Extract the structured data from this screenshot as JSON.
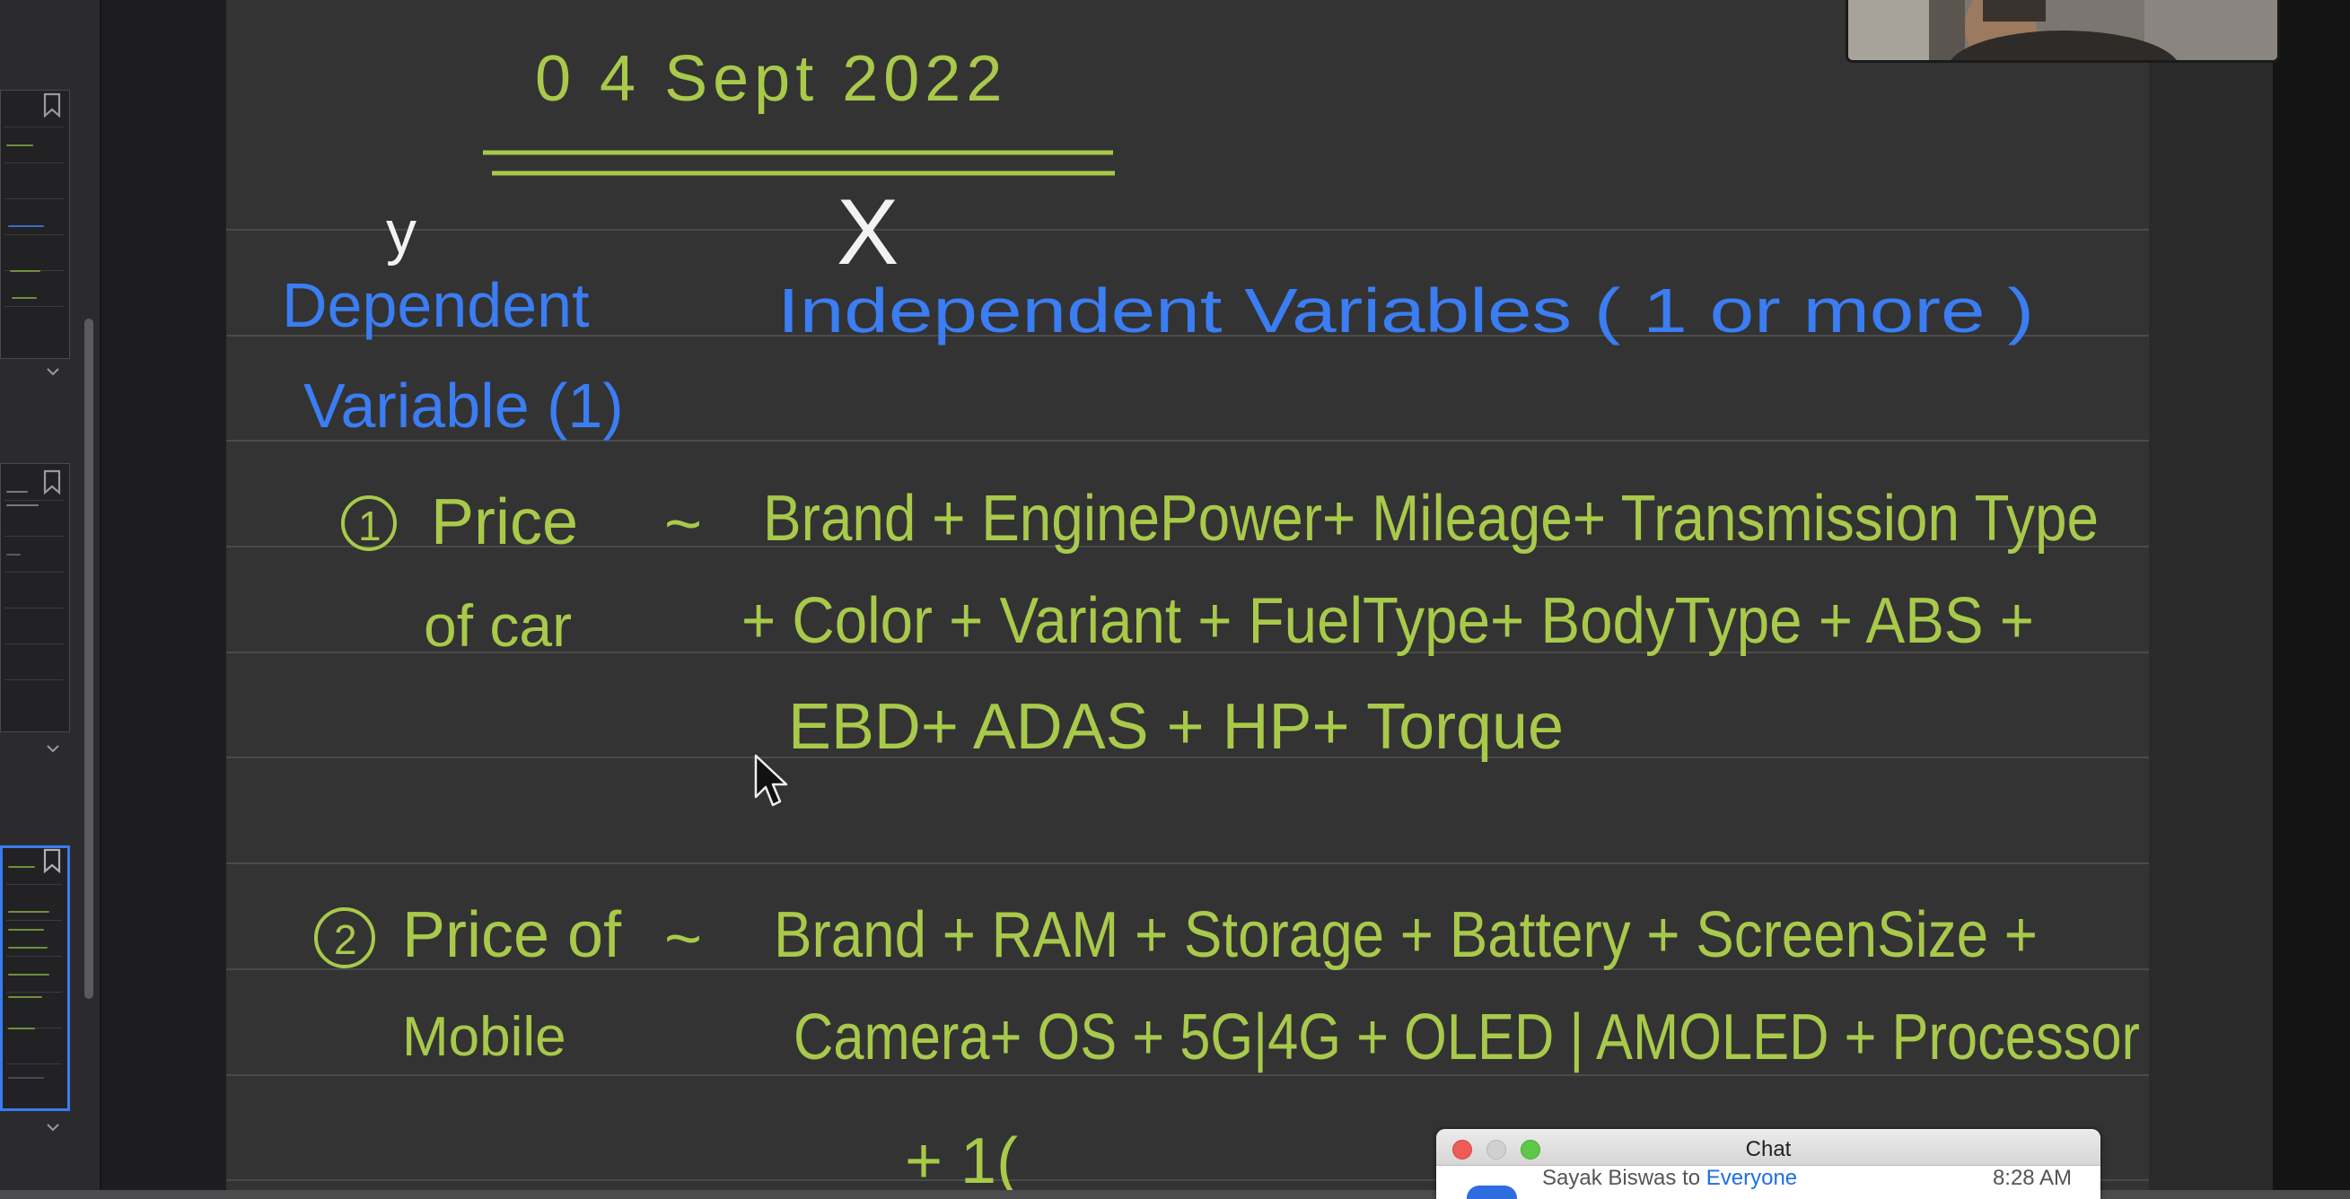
{
  "colors": {
    "ink_green": "#a8c94a",
    "ink_blue": "#3b7df2",
    "ink_white": "#f2f2f2",
    "canvas": "#333334",
    "sidebar": "#2b2b2d",
    "accent_selected": "#3a7bf0"
  },
  "note": {
    "date": "0 4   Sept  2022",
    "x_label": "X",
    "y_label": "y",
    "dependent_heading_line1": "Dependent",
    "dependent_heading_line2": "Variable (1)",
    "independent_heading": "Independent Variables ( 1  or  more )",
    "example1": {
      "number": "1",
      "target_line1": "Price",
      "target_line2": "of car",
      "tilde": "~",
      "features_line1": "Brand + EnginePower+  Mileage+  Transmission Type",
      "features_line2": "+ Color + Variant + FuelType+ BodyType + ABS +",
      "features_line3": "EBD+ ADAS + HP+  Torque"
    },
    "example2": {
      "number": "2",
      "target_line1": "Price of",
      "target_line2": "Mobile",
      "tilde": "~",
      "features_line1": "Brand + RAM + Storage + Battery + ScreenSize +",
      "features_line2": "Camera+ OS + 5G|4G +  OLED | AMOLED + Processor",
      "features_line3": "+ 1("
    }
  },
  "sidebar": {
    "icons": [
      "bookmark-icon",
      "chevron-down-icon"
    ]
  },
  "chat": {
    "title": "Chat",
    "sender_name": "Sayak Biswas",
    "sender_to": "to",
    "recipient": "Everyone",
    "time": "8:28 AM"
  }
}
